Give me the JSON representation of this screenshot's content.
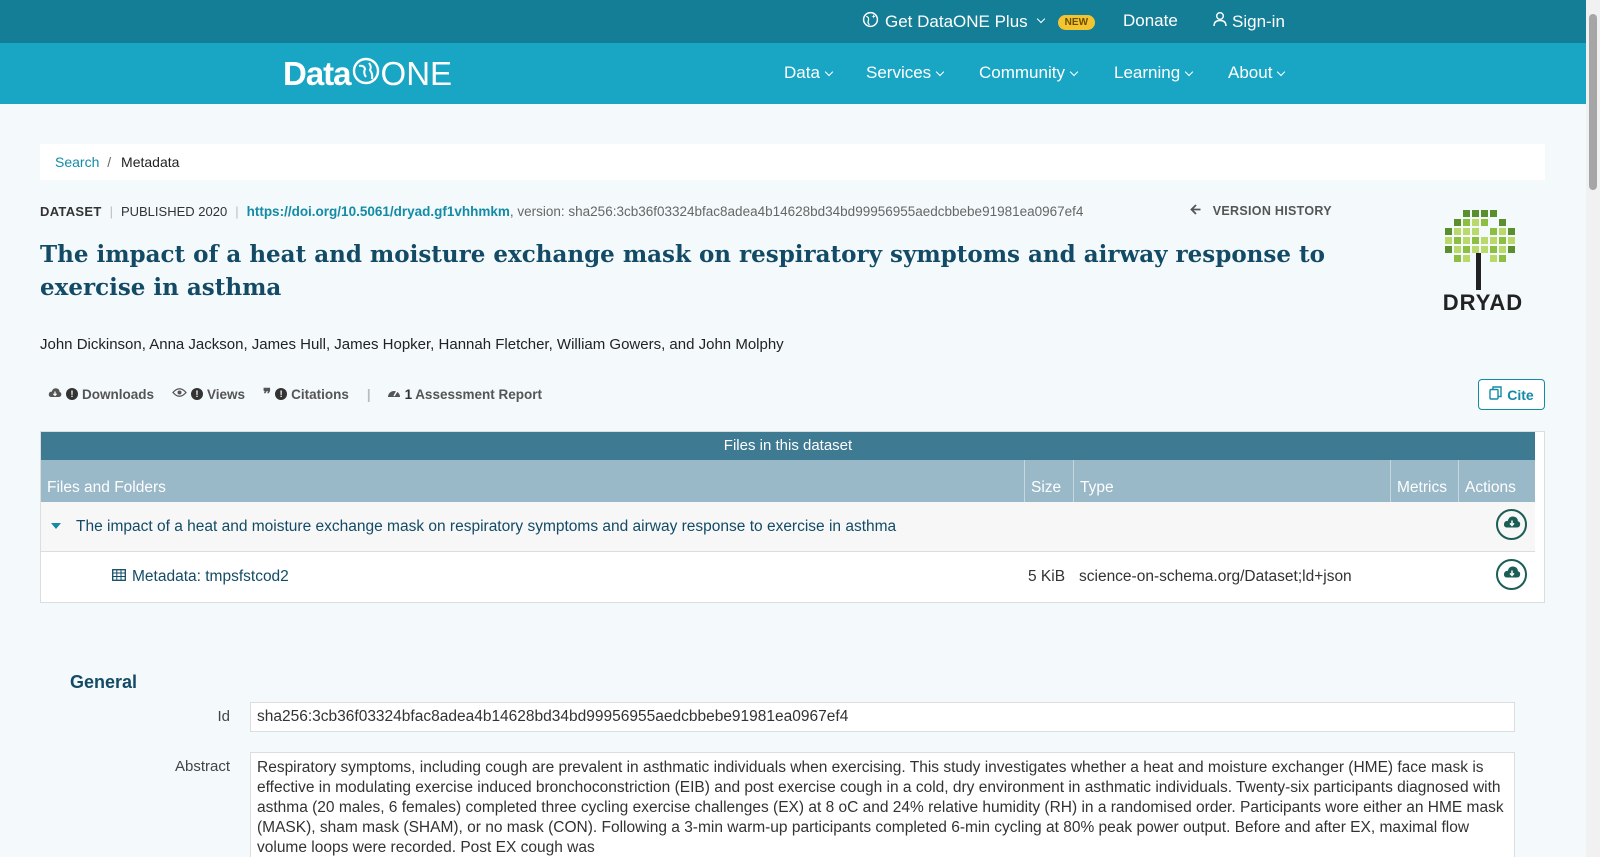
{
  "topbar": {
    "plus_label": "Get DataONE Plus",
    "new_badge": "NEW",
    "donate": "Donate",
    "signin": "Sign-in"
  },
  "nav": {
    "logo_data": "Data",
    "logo_one": "ONE",
    "items": [
      "Data",
      "Services",
      "Community",
      "Learning",
      "About"
    ]
  },
  "breadcrumb": {
    "search": "Search",
    "sep": "/",
    "current": "Metadata"
  },
  "dataset": {
    "kind": "DATASET",
    "published": "PUBLISHED 2020",
    "doi": "https://doi.org/10.5061/dryad.gf1vhhmkm",
    "version": ", version: sha256:3cb36f03324bfac8adea4b14628bd34bd99956955aedcbbebe91981ea0967ef4",
    "version_history": "VERSION HISTORY",
    "title": "The impact of a heat and moisture exchange mask on respiratory symptoms and airway response to exercise in asthma",
    "authors": "John Dickinson, Anna Jackson, James Hull, James Hopker, Hannah Fletcher, William Gowers, and John Molphy",
    "repository_logo_text": "DRYAD"
  },
  "metrics": {
    "downloads": "Downloads",
    "views": "Views",
    "citations": "Citations",
    "assessment_count": "1",
    "assessment": "Assessment Report",
    "cite": "Cite"
  },
  "files": {
    "heading": "Files in this dataset",
    "columns": [
      "Files and Folders",
      "Size",
      "Type",
      "Metrics",
      "Actions"
    ],
    "folder": "The impact of a heat and moisture exchange mask on respiratory symptoms and airway response to exercise in asthma",
    "file_name": "Metadata: tmpsfstcod2",
    "file_size": "5 KiB",
    "file_type": "science-on-schema.org/Dataset;ld+json"
  },
  "general": {
    "heading": "General",
    "id_label": "Id",
    "id_value": "sha256:3cb36f03324bfac8adea4b14628bd34bd99956955aedcbbebe91981ea0967ef4",
    "abstract_label": "Abstract",
    "abstract": "Respiratory symptoms, including cough are prevalent in asthmatic individuals when exercising. This study investigates whether a heat and moisture exchanger (HME) face mask is effective in modulating exercise induced bronchoconstriction (EIB) and post exercise cough in a cold, dry environment in asthmatic individuals. Twenty-six participants diagnosed with asthma (20 males, 6 females) completed three cycling exercise challenges (EX) at 8 oC and 24% relative humidity (RH) in a randomised order. Participants wore either an HME mask (MASK), sham mask (SHAM), or no mask (CON). Following a 3-min warm-up participants completed 6-min cycling at 80% peak power output. Before and after EX, maximal flow volume loops were recorded. Post EX cough was"
  },
  "colors": {
    "topbar": "#137e96",
    "navbar": "#19a6c4",
    "title": "#134b66",
    "link": "#138ba6",
    "table_header": "#3f7a93",
    "table_columns": "#99b8c8"
  }
}
